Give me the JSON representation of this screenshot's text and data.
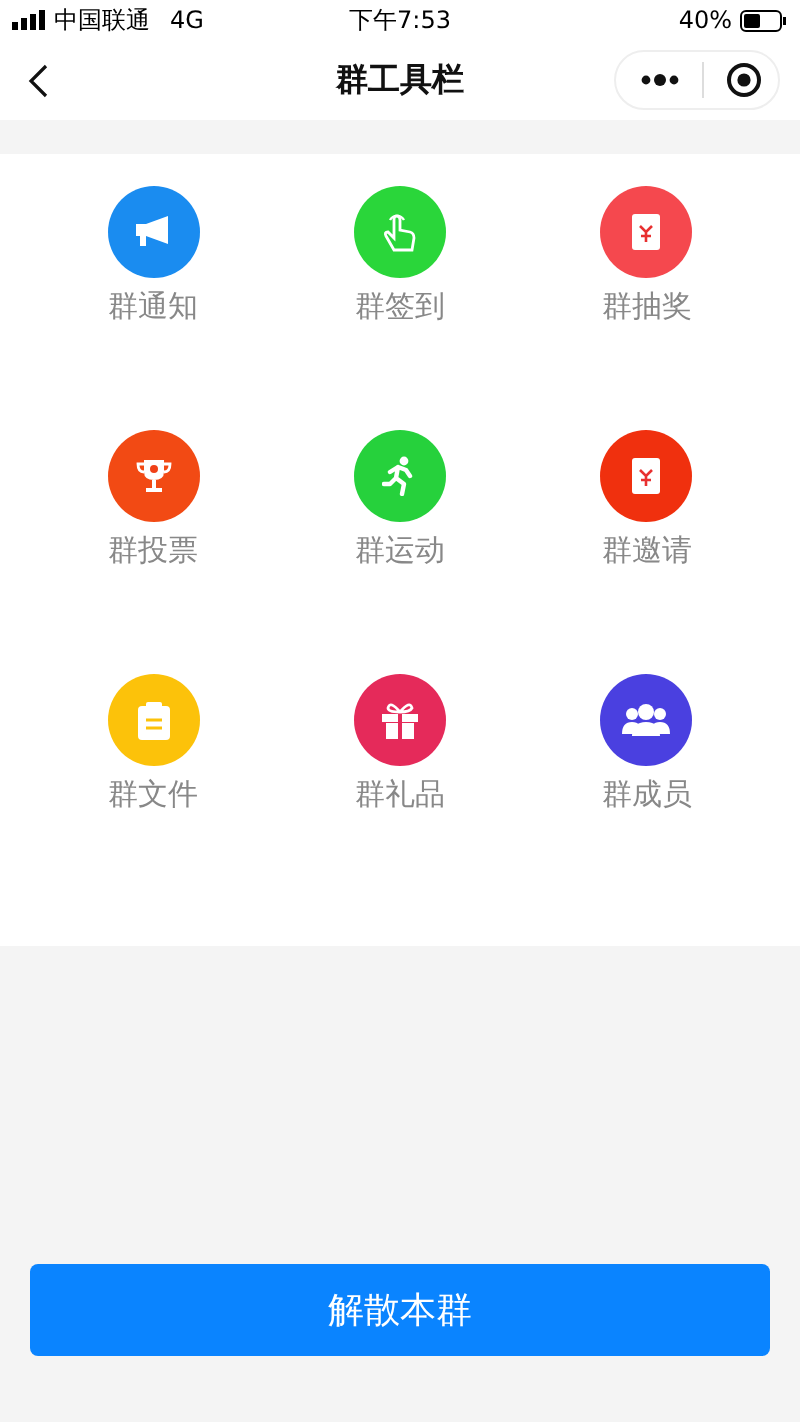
{
  "status_bar": {
    "carrier": "中国联通",
    "network": "4G",
    "time": "下午7:53",
    "battery": "40%"
  },
  "nav": {
    "title": "群工具栏"
  },
  "tools": [
    {
      "label": "群通知",
      "kind": "megaphone",
      "color": "#1a8cf0"
    },
    {
      "label": "群签到",
      "kind": "tap",
      "color": "#2ad63a"
    },
    {
      "label": "群抽奖",
      "kind": "envelope",
      "color": "#f5484e"
    },
    {
      "label": "群投票",
      "kind": "trophy",
      "color": "#f24a14"
    },
    {
      "label": "群运动",
      "kind": "runner",
      "color": "#26d13c"
    },
    {
      "label": "群邀请",
      "kind": "envelope",
      "color": "#f0300e"
    },
    {
      "label": "群文件",
      "kind": "clipboard",
      "color": "#fcc20a"
    },
    {
      "label": "群礼品",
      "kind": "gift",
      "color": "#e52a5a"
    },
    {
      "label": "群成员",
      "kind": "people",
      "color": "#4a40e0"
    }
  ],
  "action_button": "解散本群"
}
